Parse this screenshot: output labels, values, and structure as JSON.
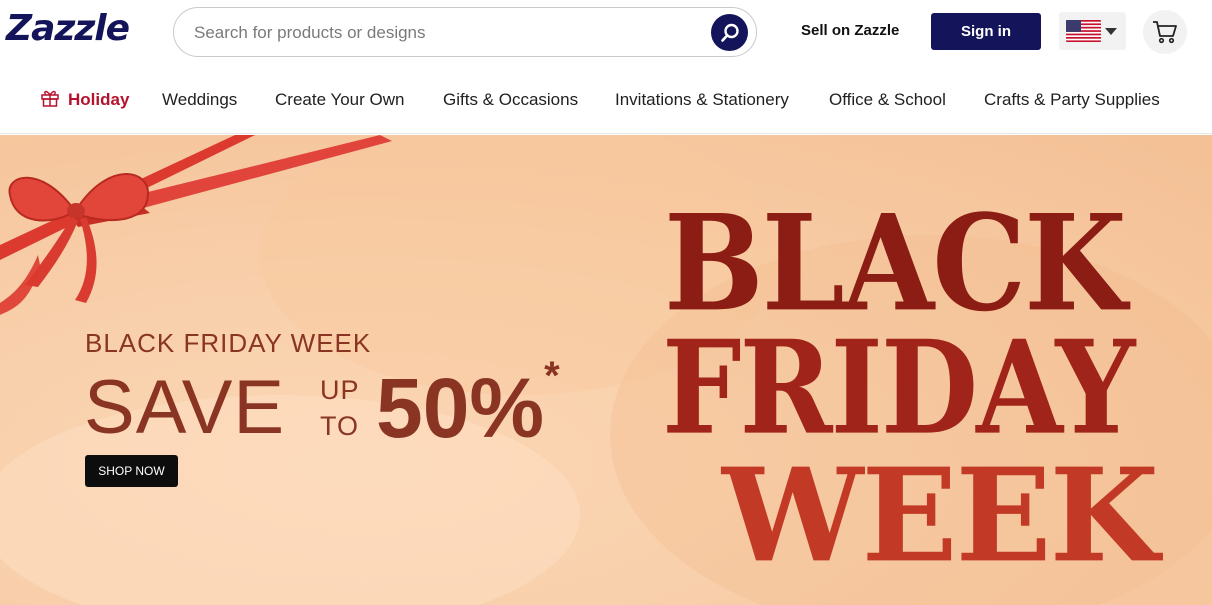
{
  "header": {
    "logo": "Zazzle",
    "search": {
      "placeholder": "Search for products or designs"
    },
    "sell_label": "Sell on Zazzle",
    "signin_label": "Sign in",
    "locale_icon": "us-flag-icon",
    "cart_icon": "cart-icon"
  },
  "nav": {
    "items": [
      {
        "label": "Holiday",
        "icon": "gift-icon"
      },
      {
        "label": "Weddings"
      },
      {
        "label": "Create Your Own"
      },
      {
        "label": "Gifts & Occasions"
      },
      {
        "label": "Invitations & Stationery"
      },
      {
        "label": "Office & School"
      },
      {
        "label": "Crafts & Party Supplies"
      }
    ]
  },
  "hero": {
    "kicker": "BLACK FRIDAY WEEK",
    "save": "SAVE",
    "up": "UP",
    "to": "TO",
    "percent": "50%",
    "asterisk": "*",
    "cta": "SHOP NOW",
    "headline_lines": [
      "BLACK",
      "FRIDAY",
      "WEEK"
    ]
  },
  "colors": {
    "brand_navy": "#14145a",
    "holiday_red": "#b5122e",
    "hero_text": "#8a3524",
    "headline_dark": "#8b1d14",
    "headline_light": "#c23a26",
    "ribbon": "#e03a2e"
  }
}
